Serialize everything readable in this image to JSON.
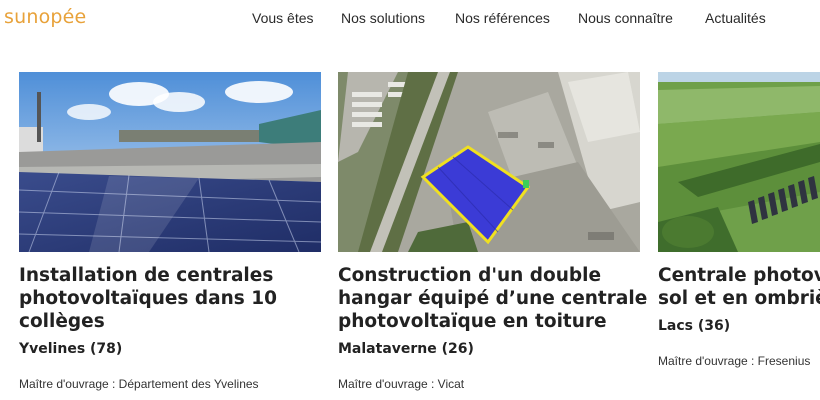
{
  "header": {
    "logo": "sunopée",
    "nav": [
      {
        "label": "Vous êtes"
      },
      {
        "label": "Nos solutions"
      },
      {
        "label": "Nos références"
      },
      {
        "label": "Nous connaître"
      },
      {
        "label": "Actualités"
      }
    ]
  },
  "cards": [
    {
      "title_lines": [
        "Installation de centrales",
        "photovoltaïques dans 10",
        "collèges"
      ],
      "location": "Yvelines (78)",
      "owner": "Maître d'ouvrage : Département des Yvelines"
    },
    {
      "title_lines": [
        "Construction d'un double",
        "hangar équipé d’une centrale",
        "photovoltaïque en toiture"
      ],
      "location": "Malataverne (26)",
      "owner": "Maître d'ouvrage : Vicat"
    },
    {
      "title_lines": [
        "Centrale photov",
        "sol et en ombrièr"
      ],
      "location": "Lacs (36)",
      "owner": "Maître d'ouvrage : Fresenius"
    }
  ],
  "colors": {
    "logo": "#e8a23a",
    "text": "#222222",
    "roof_highlight": "#3b3bd6",
    "roof_outline": "#f0e020"
  }
}
